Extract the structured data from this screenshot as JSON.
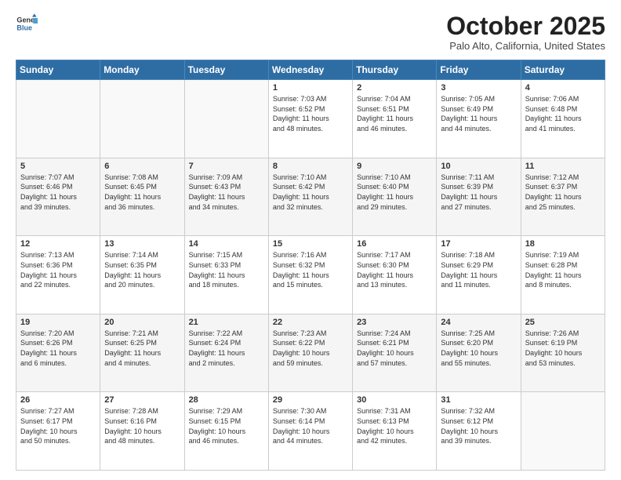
{
  "logo": {
    "line1": "General",
    "line2": "Blue"
  },
  "title": "October 2025",
  "subtitle": "Palo Alto, California, United States",
  "weekdays": [
    "Sunday",
    "Monday",
    "Tuesday",
    "Wednesday",
    "Thursday",
    "Friday",
    "Saturday"
  ],
  "weeks": [
    [
      {
        "day": "",
        "info": ""
      },
      {
        "day": "",
        "info": ""
      },
      {
        "day": "",
        "info": ""
      },
      {
        "day": "1",
        "info": "Sunrise: 7:03 AM\nSunset: 6:52 PM\nDaylight: 11 hours\nand 48 minutes."
      },
      {
        "day": "2",
        "info": "Sunrise: 7:04 AM\nSunset: 6:51 PM\nDaylight: 11 hours\nand 46 minutes."
      },
      {
        "day": "3",
        "info": "Sunrise: 7:05 AM\nSunset: 6:49 PM\nDaylight: 11 hours\nand 44 minutes."
      },
      {
        "day": "4",
        "info": "Sunrise: 7:06 AM\nSunset: 6:48 PM\nDaylight: 11 hours\nand 41 minutes."
      }
    ],
    [
      {
        "day": "5",
        "info": "Sunrise: 7:07 AM\nSunset: 6:46 PM\nDaylight: 11 hours\nand 39 minutes."
      },
      {
        "day": "6",
        "info": "Sunrise: 7:08 AM\nSunset: 6:45 PM\nDaylight: 11 hours\nand 36 minutes."
      },
      {
        "day": "7",
        "info": "Sunrise: 7:09 AM\nSunset: 6:43 PM\nDaylight: 11 hours\nand 34 minutes."
      },
      {
        "day": "8",
        "info": "Sunrise: 7:10 AM\nSunset: 6:42 PM\nDaylight: 11 hours\nand 32 minutes."
      },
      {
        "day": "9",
        "info": "Sunrise: 7:10 AM\nSunset: 6:40 PM\nDaylight: 11 hours\nand 29 minutes."
      },
      {
        "day": "10",
        "info": "Sunrise: 7:11 AM\nSunset: 6:39 PM\nDaylight: 11 hours\nand 27 minutes."
      },
      {
        "day": "11",
        "info": "Sunrise: 7:12 AM\nSunset: 6:37 PM\nDaylight: 11 hours\nand 25 minutes."
      }
    ],
    [
      {
        "day": "12",
        "info": "Sunrise: 7:13 AM\nSunset: 6:36 PM\nDaylight: 11 hours\nand 22 minutes."
      },
      {
        "day": "13",
        "info": "Sunrise: 7:14 AM\nSunset: 6:35 PM\nDaylight: 11 hours\nand 20 minutes."
      },
      {
        "day": "14",
        "info": "Sunrise: 7:15 AM\nSunset: 6:33 PM\nDaylight: 11 hours\nand 18 minutes."
      },
      {
        "day": "15",
        "info": "Sunrise: 7:16 AM\nSunset: 6:32 PM\nDaylight: 11 hours\nand 15 minutes."
      },
      {
        "day": "16",
        "info": "Sunrise: 7:17 AM\nSunset: 6:30 PM\nDaylight: 11 hours\nand 13 minutes."
      },
      {
        "day": "17",
        "info": "Sunrise: 7:18 AM\nSunset: 6:29 PM\nDaylight: 11 hours\nand 11 minutes."
      },
      {
        "day": "18",
        "info": "Sunrise: 7:19 AM\nSunset: 6:28 PM\nDaylight: 11 hours\nand 8 minutes."
      }
    ],
    [
      {
        "day": "19",
        "info": "Sunrise: 7:20 AM\nSunset: 6:26 PM\nDaylight: 11 hours\nand 6 minutes."
      },
      {
        "day": "20",
        "info": "Sunrise: 7:21 AM\nSunset: 6:25 PM\nDaylight: 11 hours\nand 4 minutes."
      },
      {
        "day": "21",
        "info": "Sunrise: 7:22 AM\nSunset: 6:24 PM\nDaylight: 11 hours\nand 2 minutes."
      },
      {
        "day": "22",
        "info": "Sunrise: 7:23 AM\nSunset: 6:22 PM\nDaylight: 10 hours\nand 59 minutes."
      },
      {
        "day": "23",
        "info": "Sunrise: 7:24 AM\nSunset: 6:21 PM\nDaylight: 10 hours\nand 57 minutes."
      },
      {
        "day": "24",
        "info": "Sunrise: 7:25 AM\nSunset: 6:20 PM\nDaylight: 10 hours\nand 55 minutes."
      },
      {
        "day": "25",
        "info": "Sunrise: 7:26 AM\nSunset: 6:19 PM\nDaylight: 10 hours\nand 53 minutes."
      }
    ],
    [
      {
        "day": "26",
        "info": "Sunrise: 7:27 AM\nSunset: 6:17 PM\nDaylight: 10 hours\nand 50 minutes."
      },
      {
        "day": "27",
        "info": "Sunrise: 7:28 AM\nSunset: 6:16 PM\nDaylight: 10 hours\nand 48 minutes."
      },
      {
        "day": "28",
        "info": "Sunrise: 7:29 AM\nSunset: 6:15 PM\nDaylight: 10 hours\nand 46 minutes."
      },
      {
        "day": "29",
        "info": "Sunrise: 7:30 AM\nSunset: 6:14 PM\nDaylight: 10 hours\nand 44 minutes."
      },
      {
        "day": "30",
        "info": "Sunrise: 7:31 AM\nSunset: 6:13 PM\nDaylight: 10 hours\nand 42 minutes."
      },
      {
        "day": "31",
        "info": "Sunrise: 7:32 AM\nSunset: 6:12 PM\nDaylight: 10 hours\nand 39 minutes."
      },
      {
        "day": "",
        "info": ""
      }
    ]
  ]
}
